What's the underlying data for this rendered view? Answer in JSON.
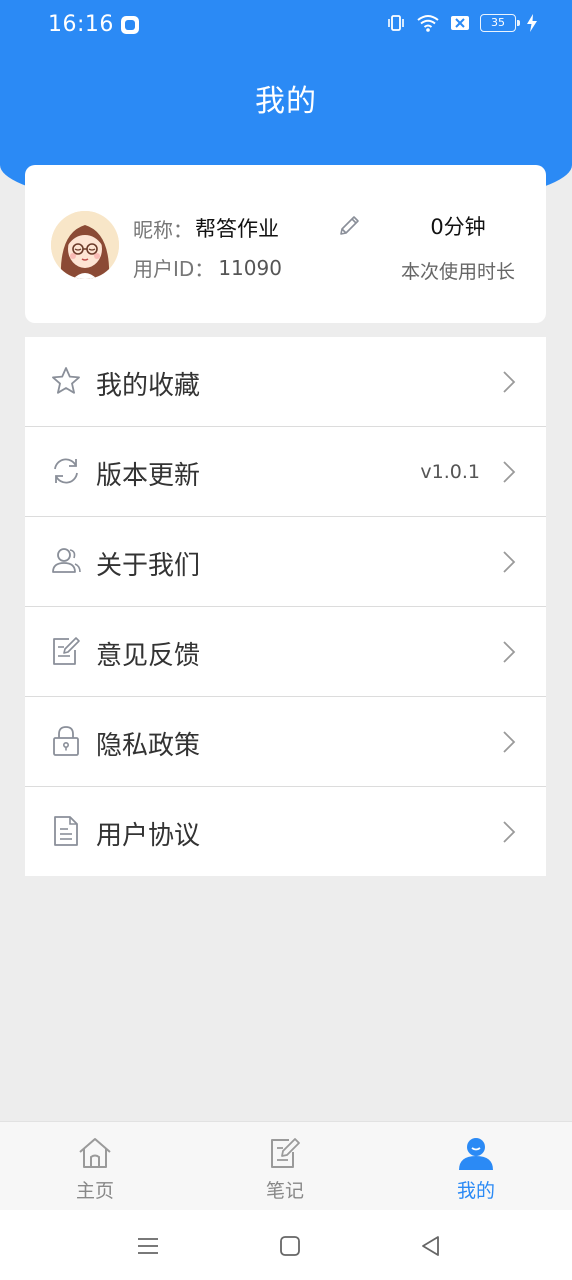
{
  "status_bar": {
    "time": "16:16",
    "battery": "35"
  },
  "header": {
    "title": "我的"
  },
  "profile": {
    "nickname_label": "昵称：",
    "nickname": "帮答作业",
    "user_id_label": "用户ID：",
    "user_id": "11090",
    "usage_value": "0分钟",
    "usage_label": "本次使用时长"
  },
  "menu": {
    "items": [
      {
        "label": "我的收藏",
        "icon": "star-icon",
        "value": ""
      },
      {
        "label": "版本更新",
        "icon": "refresh-icon",
        "value": "v1.0.1"
      },
      {
        "label": "关于我们",
        "icon": "users-icon",
        "value": ""
      },
      {
        "label": "意见反馈",
        "icon": "feedback-icon",
        "value": ""
      },
      {
        "label": "隐私政策",
        "icon": "lock-icon",
        "value": ""
      },
      {
        "label": "用户协议",
        "icon": "document-icon",
        "value": ""
      }
    ]
  },
  "bottom_nav": {
    "items": [
      {
        "label": "主页",
        "icon": "home-icon",
        "active": false
      },
      {
        "label": "笔记",
        "icon": "notes-icon",
        "active": false
      },
      {
        "label": "我的",
        "icon": "profile-icon",
        "active": true
      }
    ]
  },
  "colors": {
    "accent": "#2b8af5",
    "background": "#ededed",
    "icon_gray": "#8a8f99"
  }
}
